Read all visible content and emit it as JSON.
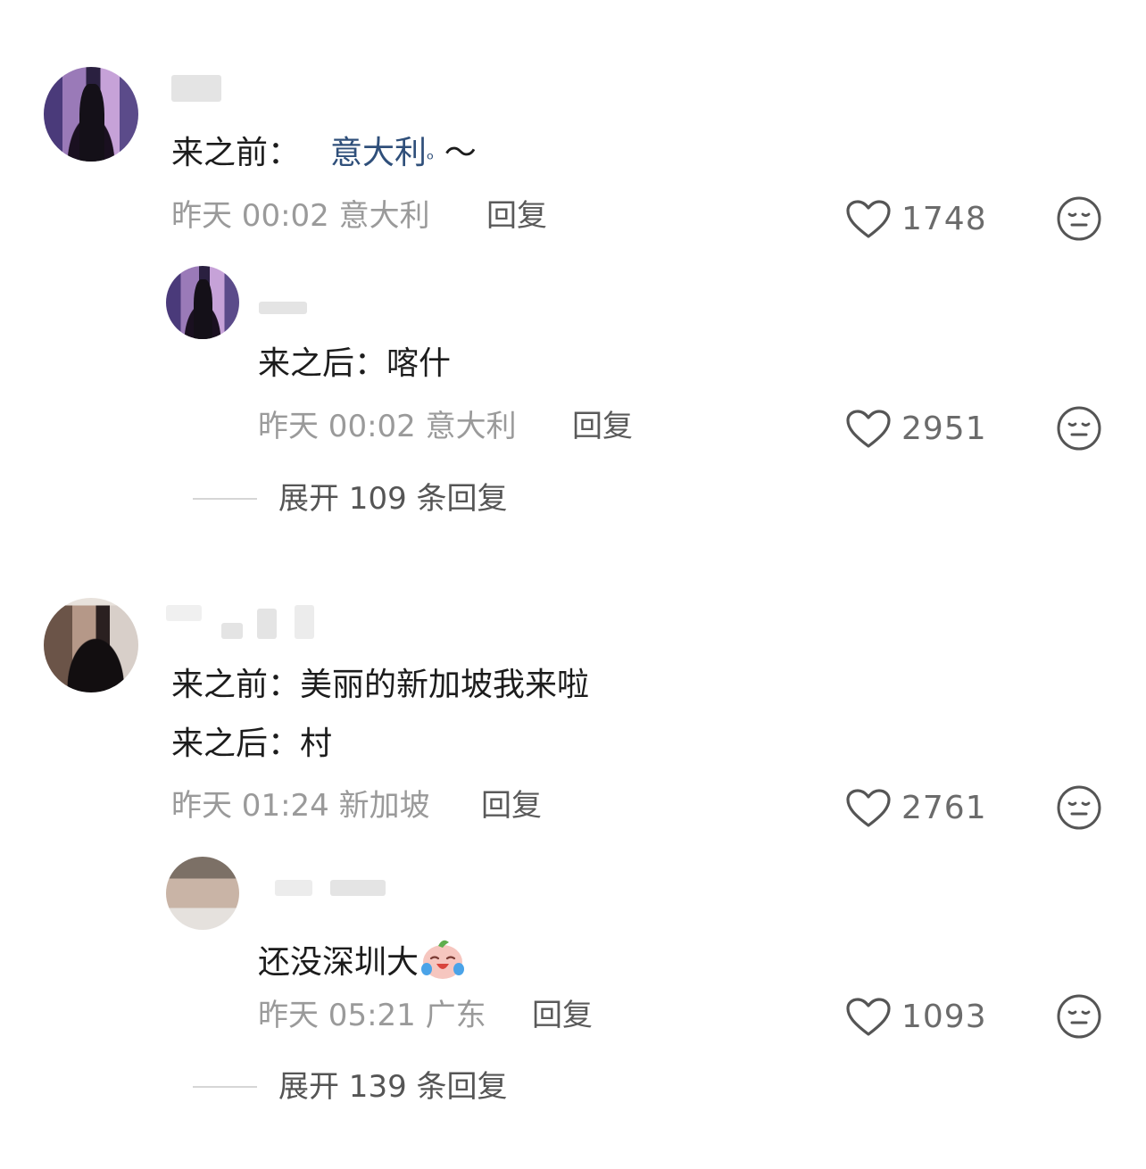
{
  "comments": [
    {
      "text_prefix": "来之前：",
      "link_text": "意大利",
      "text_suffix": " ～",
      "time": "昨天 00:02",
      "location": "意大利",
      "reply_label": "回复",
      "likes": "1748",
      "reply": {
        "text": "来之后：喀什",
        "time": "昨天 00:02",
        "location": "意大利",
        "reply_label": "回复",
        "likes": "2951"
      },
      "expand_label": "展开 109 条回复"
    },
    {
      "line1": "来之前：美丽的新加坡我来啦",
      "line2": "来之后：村",
      "time": "昨天 01:24",
      "location": "新加坡",
      "reply_label": "回复",
      "likes": "2761",
      "reply": {
        "text": "还没深圳大",
        "time": "昨天 05:21",
        "location": "广东",
        "reply_label": "回复",
        "likes": "1093"
      },
      "expand_label": "展开 139 条回复"
    }
  ],
  "icons": {
    "like": "heart-outline-icon",
    "dislike": "neutral-face-icon",
    "search": "search-icon",
    "emoji": "crying-laughing-emoji"
  },
  "colors": {
    "link": "#2f4f7a",
    "meta": "#9a9a9a",
    "text": "#1c1c1c"
  }
}
